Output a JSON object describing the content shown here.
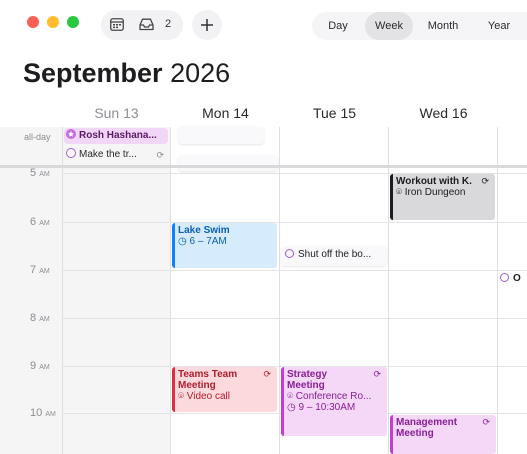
{
  "window": {
    "traffic_lights": {
      "close": "#ff5f57",
      "minimize": "#febc2e",
      "zoom": "#28c840"
    }
  },
  "toolbar": {
    "calendars_icon": "calendar-list-icon",
    "inbox_icon": "inbox-icon",
    "inbox_count": "2",
    "add_icon": "plus-icon",
    "views": [
      "Day",
      "Week",
      "Month",
      "Year"
    ],
    "active_view": "Week"
  },
  "header": {
    "month": "September",
    "year": "2026"
  },
  "days": [
    {
      "label": "Sun 13",
      "weekend": true
    },
    {
      "label": "Mon 14",
      "weekend": false
    },
    {
      "label": "Tue 15",
      "weekend": false
    },
    {
      "label": "Wed 16",
      "weekend": false
    }
  ],
  "allday": {
    "label": "all-day",
    "events": [
      {
        "title": "Rosh Hashana...",
        "icon": "star-circle-icon",
        "color": "#c26fd8"
      },
      {
        "title": "Make the tr...",
        "icon": "task-circle-icon",
        "repeat_icon": "repeat-icon",
        "color": "#a05ed0"
      }
    ]
  },
  "hours": [
    {
      "num": "5",
      "ap": "AM"
    },
    {
      "num": "6",
      "ap": "AM"
    },
    {
      "num": "7",
      "ap": "AM"
    },
    {
      "num": "8",
      "ap": "AM"
    },
    {
      "num": "9",
      "ap": "AM"
    },
    {
      "num": "10",
      "ap": "AM"
    }
  ],
  "events": {
    "workout": {
      "title": "Workout with K.",
      "location": "Iron Dungeon",
      "color": "#1c1c1e",
      "bg": "#d9d9db"
    },
    "lake_swim": {
      "title": "Lake Swim",
      "time": "6 – 7AM",
      "color": "#0a84ff",
      "bg": "#d6ebfb"
    },
    "shut_off": {
      "title": "Shut off the bo..."
    },
    "teams": {
      "title": "Teams Team Meeting",
      "location": "Video call",
      "color": "#e0303f",
      "bg": "#fbd9dd"
    },
    "strategy": {
      "title": "Strategy Meeting",
      "location": "Conference Ro...",
      "time": "9 – 10:30AM",
      "color": "#c43dd2",
      "bg": "#f5d7f7"
    },
    "management": {
      "title": "Management Meeting",
      "color": "#c43dd2",
      "bg": "#f5d7f7"
    },
    "edge_task": {
      "title": "O"
    }
  }
}
